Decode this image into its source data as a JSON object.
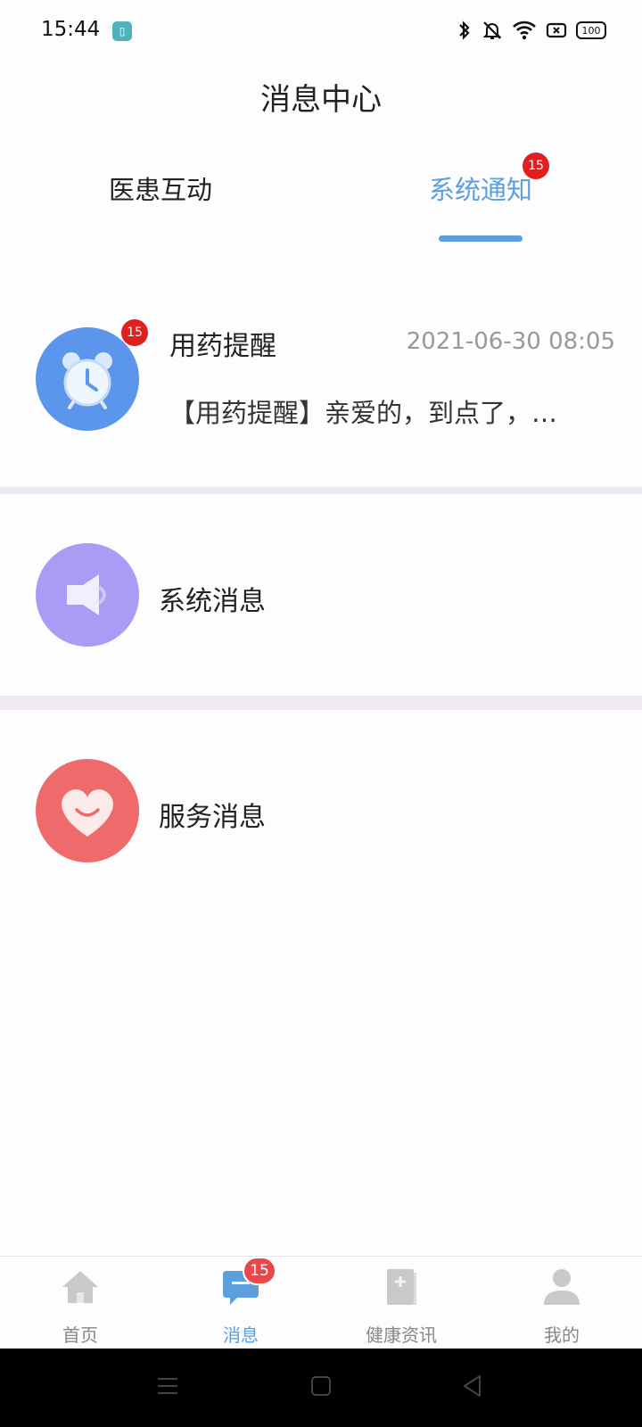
{
  "status_bar": {
    "time": "15:44",
    "battery": "100",
    "icons": [
      "bluetooth-icon",
      "bell-off-icon",
      "wifi-icon",
      "sim-icon",
      "battery-icon"
    ]
  },
  "header": {
    "title": "消息中心"
  },
  "tabs": [
    {
      "label": "医患互动",
      "active": false
    },
    {
      "label": "系统通知",
      "active": true,
      "badge": "15"
    }
  ],
  "messages": [
    {
      "title": "用药提醒",
      "time": "2021-06-30 08:05",
      "preview": "【用药提醒】亲爱的，到点了，…",
      "badge": "15",
      "icon": "alarm-clock-icon",
      "color": "#5b95ec"
    },
    {
      "title": "系统消息",
      "icon": "speaker-icon",
      "color": "#a99cf4"
    },
    {
      "title": "服务消息",
      "icon": "heart-icon",
      "color": "#ef6a6a"
    }
  ],
  "bottom_nav": [
    {
      "label": "首页",
      "icon": "home-icon",
      "active": false
    },
    {
      "label": "消息",
      "icon": "chat-icon",
      "active": true,
      "badge": "15"
    },
    {
      "label": "健康资讯",
      "icon": "book-icon",
      "active": false
    },
    {
      "label": "我的",
      "icon": "user-icon",
      "active": false
    }
  ],
  "colors": {
    "accent": "#5b9fdf",
    "badge": "#e02020",
    "divider": "#efeaf2"
  }
}
